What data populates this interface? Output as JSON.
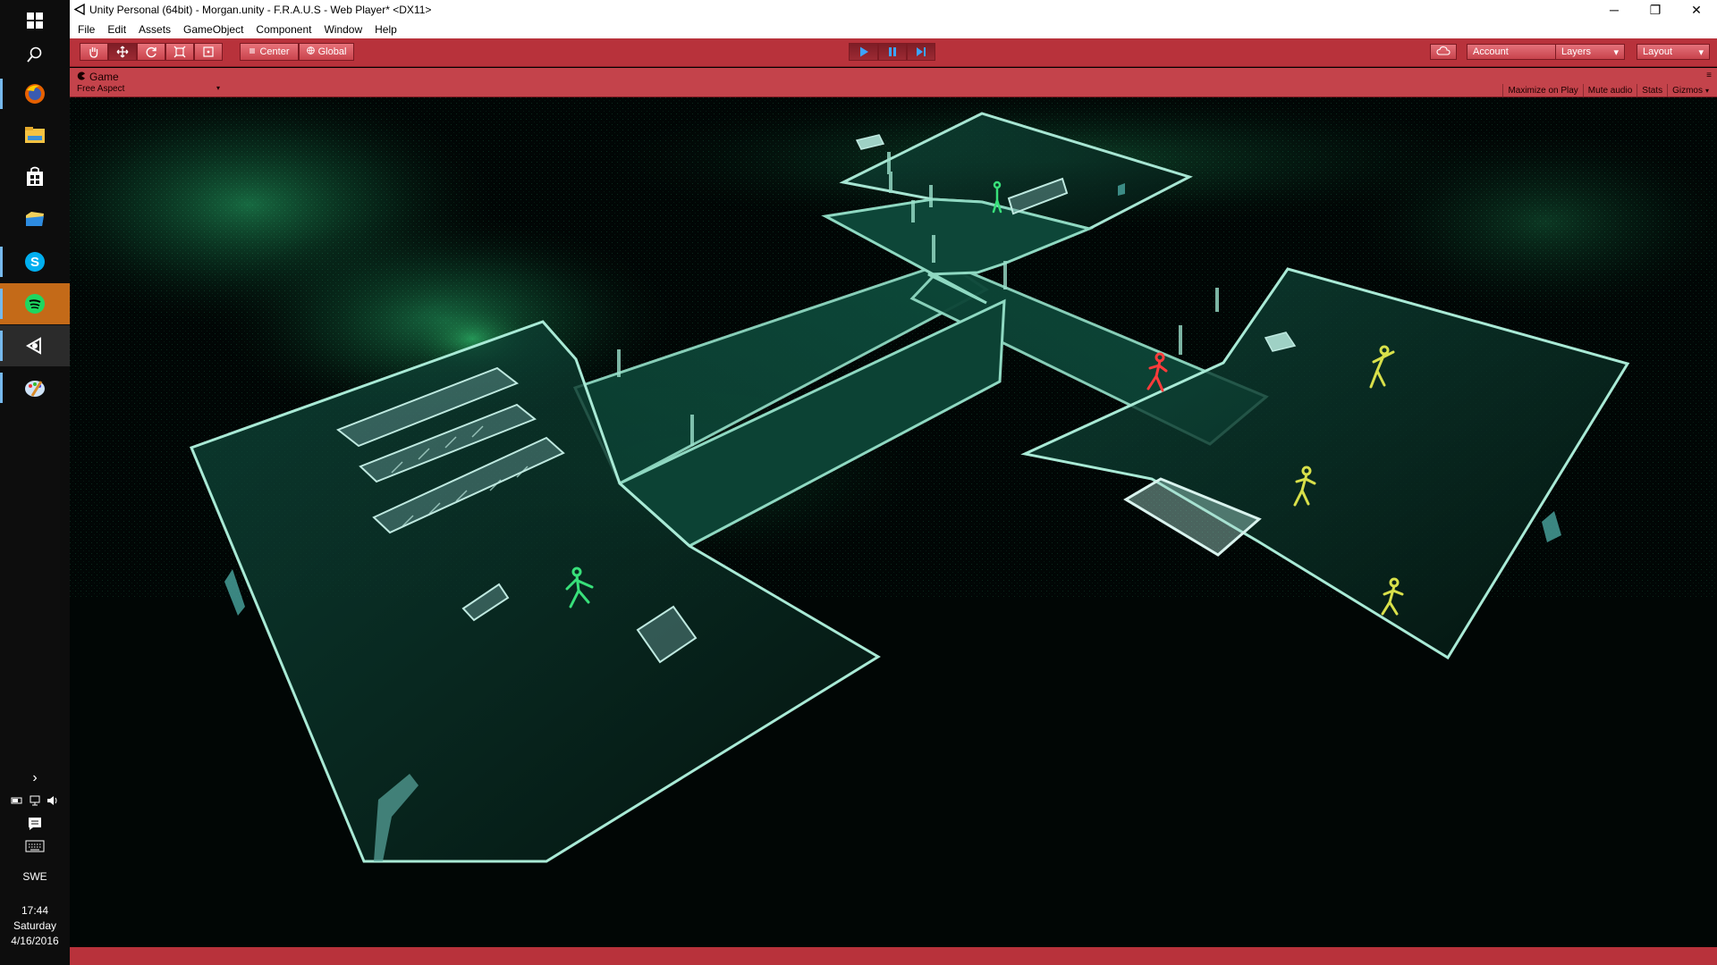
{
  "window": {
    "title": "Unity Personal (64bit) - Morgan.unity - F.R.A.U.S - Web Player* <DX11>",
    "minimize": "─",
    "restore": "❐",
    "close": "✕"
  },
  "menu": {
    "items": [
      {
        "label": "File"
      },
      {
        "label": "Edit"
      },
      {
        "label": "Assets"
      },
      {
        "label": "GameObject"
      },
      {
        "label": "Component"
      },
      {
        "label": "Window"
      },
      {
        "label": "Help"
      }
    ]
  },
  "toolbar": {
    "pivot_label": "Center",
    "space_label": "Global",
    "account_label": "Account",
    "layers_label": "Layers",
    "layout_label": "Layout",
    "play_active": true,
    "accent_color": "#b8323b"
  },
  "game_panel": {
    "tab_label": "Game",
    "aspect_label": "Free Aspect",
    "options": [
      {
        "label": "Maximize on Play"
      },
      {
        "label": "Mute audio"
      },
      {
        "label": "Stats"
      },
      {
        "label": "Gizmos"
      }
    ]
  },
  "taskbar": {
    "icons": [
      "windows-start-icon",
      "search-icon",
      "firefox-icon",
      "file-explorer-icon",
      "store-icon",
      "folder-icon",
      "skype-icon",
      "spotify-icon",
      "unity-icon",
      "paint-icon"
    ],
    "show_hidden": "›",
    "language": "SWE",
    "time": "17:44",
    "day": "Saturday",
    "date": "4/16/2016"
  }
}
